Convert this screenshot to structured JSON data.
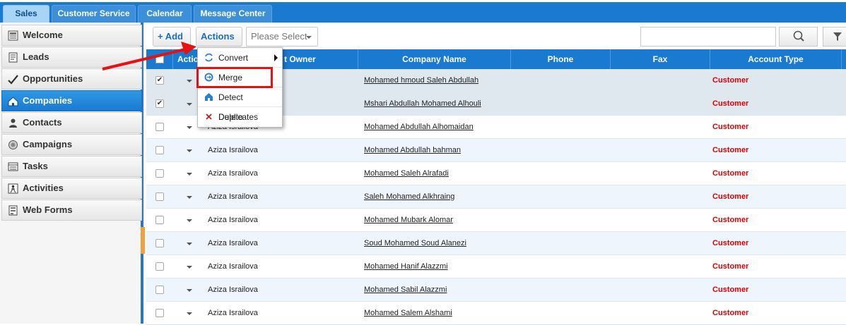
{
  "tabs": [
    "Sales",
    "Customer Service",
    "Calendar",
    "Message Center"
  ],
  "sidebar": {
    "items": [
      {
        "label": "Welcome",
        "icon": "welcome-icon"
      },
      {
        "label": "Leads",
        "icon": "leads-icon"
      },
      {
        "label": "Opportunities",
        "icon": "opportunities-icon"
      },
      {
        "label": "Companies",
        "icon": "companies-icon"
      },
      {
        "label": "Contacts",
        "icon": "contacts-icon"
      },
      {
        "label": "Campaigns",
        "icon": "campaigns-icon"
      },
      {
        "label": "Tasks",
        "icon": "tasks-icon"
      },
      {
        "label": "Activities",
        "icon": "activities-icon"
      },
      {
        "label": "Web Forms",
        "icon": "web-forms-icon"
      }
    ],
    "active": "Companies"
  },
  "toolbar": {
    "add_label": "+ Add",
    "actions_label": "Actions",
    "select_placeholder": "Please Select",
    "search_value": ""
  },
  "grid": {
    "columns": [
      "Actio",
      "t Owner",
      "Company Name",
      "Phone",
      "Fax",
      "Account Type"
    ],
    "rows": [
      {
        "checked": true,
        "owner": "",
        "company": "Mohamed hmoud Saleh Abdullah",
        "phone": "",
        "fax": "",
        "account_type": "Customer"
      },
      {
        "checked": true,
        "owner": "",
        "company": "Mshari Abdullah Mohamed Alhouli",
        "phone": "",
        "fax": "",
        "account_type": "Customer"
      },
      {
        "checked": false,
        "owner": "Aziza Israilova",
        "company": "Mohamed Abdullah Alhomaidan",
        "phone": "",
        "fax": "",
        "account_type": "Customer"
      },
      {
        "checked": false,
        "owner": "Aziza Israilova",
        "company": "Mohamed Abdullah bahman",
        "phone": "",
        "fax": "",
        "account_type": "Customer"
      },
      {
        "checked": false,
        "owner": "Aziza Israilova",
        "company": "Mohamed Saleh Alrafadi",
        "phone": "",
        "fax": "",
        "account_type": "Customer"
      },
      {
        "checked": false,
        "owner": "Aziza Israilova",
        "company": "Saleh Mohamed Alkhraing",
        "phone": "",
        "fax": "",
        "account_type": "Customer"
      },
      {
        "checked": false,
        "owner": "Aziza Israilova",
        "company": "Mohamed Mubark Alomar",
        "phone": "",
        "fax": "",
        "account_type": "Customer"
      },
      {
        "checked": false,
        "owner": "Aziza Israilova",
        "company": "Soud Mohamed Soud Alanezi",
        "phone": "",
        "fax": "",
        "account_type": "Customer"
      },
      {
        "checked": false,
        "owner": "Aziza Israilova",
        "company": "Mohamed Hanif Alazzmi",
        "phone": "",
        "fax": "",
        "account_type": "Customer"
      },
      {
        "checked": false,
        "owner": "Aziza Israilova",
        "company": "Mohamed Sabil Alazzmi",
        "phone": "",
        "fax": "",
        "account_type": "Customer"
      },
      {
        "checked": false,
        "owner": "Aziza Israilova",
        "company": "Mohamed Salem Alshami",
        "phone": "",
        "fax": "",
        "account_type": "Customer"
      }
    ]
  },
  "actions_menu": {
    "items": [
      {
        "label": "Convert",
        "icon": "convert-icon",
        "has_submenu": true
      },
      {
        "label": "Merge",
        "icon": "merge-icon",
        "has_submenu": false
      },
      {
        "label": "Detect Duplicates",
        "icon": "detect-duplicates-icon",
        "has_submenu": false
      },
      {
        "label": "Delete",
        "icon": "delete-icon",
        "has_submenu": false
      }
    ],
    "highlighted": "Merge"
  },
  "colors": {
    "brand_blue": "#1a7ad0",
    "account_type_red": "#e00000",
    "annotation_red": "#e81010"
  }
}
